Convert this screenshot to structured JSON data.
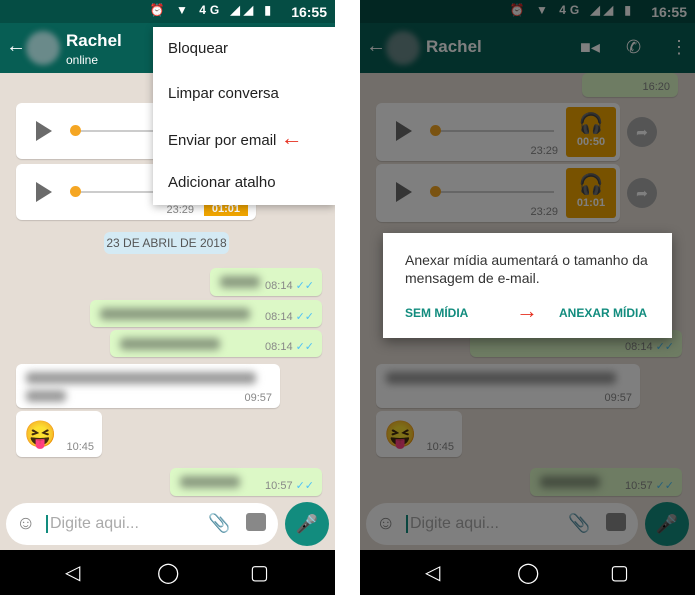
{
  "status": {
    "time": "16:55",
    "network": "4G"
  },
  "chat": {
    "contact": "Rachel",
    "presence": "online",
    "input_placeholder": "Digite aqui..."
  },
  "menu": {
    "items": [
      "Bloquear",
      "Limpar conversa",
      "Enviar por email",
      "Adicionar atalho"
    ],
    "highlighted": "Enviar por email"
  },
  "messages": {
    "audio1": {
      "time": "23:29",
      "duration": "00:50"
    },
    "audio2": {
      "time": "23:29",
      "duration": "01:01"
    },
    "date": "23 DE ABRIL DE 2018",
    "sent_times": [
      "08:14",
      "08:14",
      "08:14"
    ],
    "received_time": "09:57",
    "emoji": "😝",
    "emoji_time": "10:45",
    "last_sent_time": "10:57",
    "earlier_sent_time": "16:20"
  },
  "dialog": {
    "message": "Anexar mídia aumentará o tamanho da mensagem de e-mail.",
    "negative": "SEM MÍDIA",
    "positive": "ANEXAR MÍDIA"
  },
  "colors": {
    "header": "#075e54",
    "accent": "#128c7e",
    "arrow": "#e53020",
    "audio_badge": "#f0a500"
  }
}
